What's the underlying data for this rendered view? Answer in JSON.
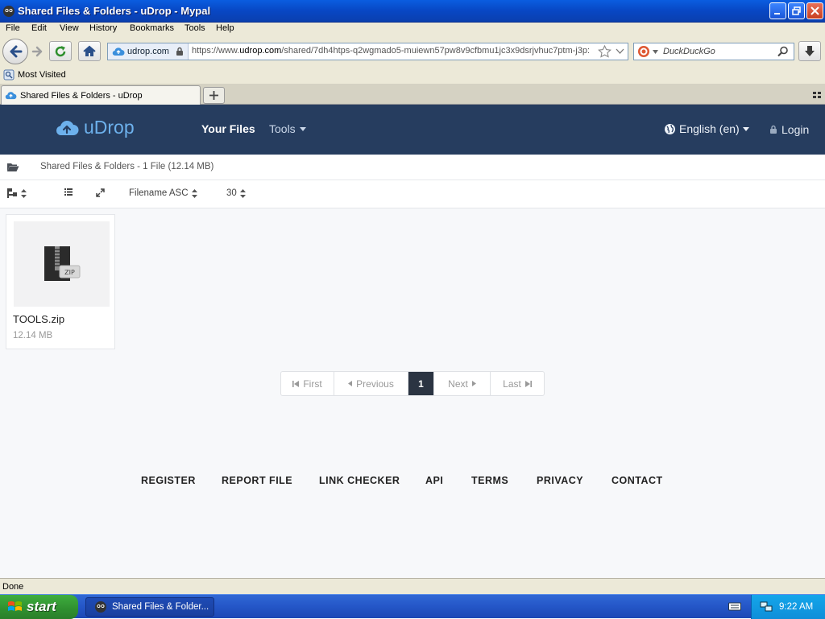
{
  "window": {
    "title": "Shared Files & Folders - uDrop - Mypal"
  },
  "menu": [
    "File",
    "Edit",
    "View",
    "History",
    "Bookmarks",
    "Tools",
    "Help"
  ],
  "address": {
    "domain": "udrop.com",
    "url_prefix": "https://www.",
    "url_domain": "udrop.com",
    "url_path": "/shared/7dh4htps-q2wgmado5-muiewn57pw8v9cfbmu1jc3x9dsrjvhuc7ptm-j3p:"
  },
  "search": {
    "placeholder": "DuckDuckGo"
  },
  "bookmarks": {
    "most_visited": "Most Visited"
  },
  "tab": {
    "title": "Shared Files & Folders - uDrop"
  },
  "site": {
    "logo": "uDrop",
    "nav": {
      "your_files": "Your Files",
      "tools": "Tools"
    },
    "language": "English (en)",
    "login": "Login"
  },
  "breadcrumb": "Shared Files & Folders - 1 File (12.14 MB)",
  "toolbar": {
    "sort": "Filename ASC",
    "per_page": "30"
  },
  "file": {
    "name": "TOOLS.zip",
    "size": "12.14 MB",
    "badge": "ZIP"
  },
  "pagination": {
    "first": "First",
    "previous": "Previous",
    "current": "1",
    "next": "Next",
    "last": "Last"
  },
  "footer": [
    "REGISTER",
    "REPORT FILE",
    "LINK CHECKER",
    "API",
    "TERMS",
    "PRIVACY",
    "CONTACT"
  ],
  "status": "Done",
  "taskbar": {
    "start": "start",
    "task": "Shared Files & Folder...",
    "clock": "9:22 AM"
  },
  "colors": {
    "site_nav": "#263d5f",
    "logo": "#6db1ec",
    "page_bg": "#f7f8fa",
    "pager_active": "#2b3442"
  }
}
